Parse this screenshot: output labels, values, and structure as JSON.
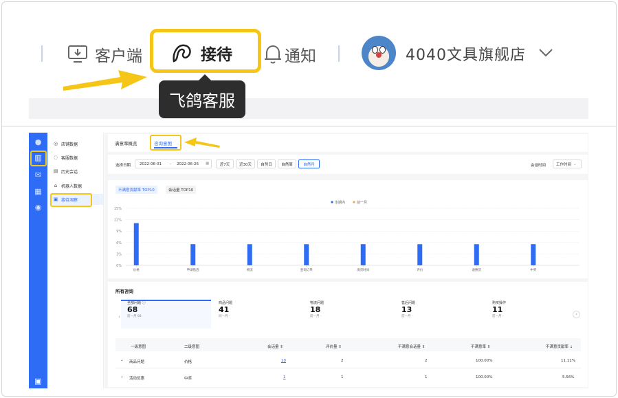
{
  "header": {
    "client_label": "客户端",
    "reception_label": "接待",
    "notify_label": "通知",
    "store_name": "4040文具旗舰店",
    "tooltip": "飞鸽客服"
  },
  "sidebar_menu": [
    {
      "label": "店铺数据",
      "icon": "◎"
    },
    {
      "label": "客服数据",
      "icon": "◌"
    },
    {
      "label": "历史会话",
      "icon": "▤"
    },
    {
      "label": "机器人数据",
      "icon": "⌂"
    },
    {
      "label": "接待洞察",
      "icon": "▣"
    }
  ],
  "tabs": {
    "satisfaction": "满意率概览",
    "intent": "咨询意图"
  },
  "filters": {
    "date_label": "选择日期",
    "start": "2022-06-01",
    "sep": "-",
    "end": "2022-06-26",
    "ranges": [
      "近7天",
      "近30天",
      "自然日",
      "自然周",
      "自然月"
    ],
    "time_label": "会话时间",
    "time_value": "工作时间"
  },
  "chart_tabs": {
    "active": "不满意贡献率 TOP10",
    "other": "会话量 TOP10"
  },
  "legend": {
    "current": "本期内",
    "previous": "前一月"
  },
  "colors": {
    "accent": "#2f6cf6",
    "highlight": "#f5c518",
    "previous": "#f0a85a"
  },
  "chart_data": {
    "type": "bar",
    "categories": [
      "价格",
      "申请售后",
      "物流",
      "查询订单",
      "发货时间",
      "评价",
      "退换货",
      "中奖"
    ],
    "series": [
      {
        "name": "本期内",
        "values": [
          11.1,
          5.56,
          5.56,
          5.56,
          5.56,
          5.56,
          5.56,
          5.56
        ]
      }
    ],
    "yticks": [
      "0%",
      "3%",
      "6%",
      "9%",
      "12%",
      "15%"
    ],
    "ylim": [
      0,
      15
    ]
  },
  "consult": {
    "title": "所有咨询",
    "stats": [
      {
        "label": "全部问题 ⓘ",
        "value": "68",
        "sub": "前一月 68"
      },
      {
        "label": "商品问题",
        "value": "41",
        "sub": "同一月 -"
      },
      {
        "label": "物流问题",
        "value": "18",
        "sub": "前一月 -"
      },
      {
        "label": "售后问题",
        "value": "13",
        "sub": "前一月 -"
      },
      {
        "label": "购买操作",
        "value": "11",
        "sub": "前一月 -"
      }
    ]
  },
  "table": {
    "headers": [
      "一级意图",
      "二级意图",
      "会话量 ⇕",
      "评价量 ⇕",
      "不满意会话量 ⇕",
      "不满意率 ⇕",
      "不满意贡献率 ⇣"
    ],
    "rows": [
      {
        "level1": "商品问题",
        "level2": "价格",
        "sessions": "10",
        "reviews": "2",
        "unsat_sessions": "2",
        "unsat_rate": "100.00%",
        "contrib": "11.11%"
      },
      {
        "level1": "活动优惠",
        "level2": "中奖",
        "sessions": "1",
        "reviews": "1",
        "unsat_sessions": "1",
        "unsat_rate": "100.00%",
        "contrib": "5.56%"
      }
    ]
  }
}
